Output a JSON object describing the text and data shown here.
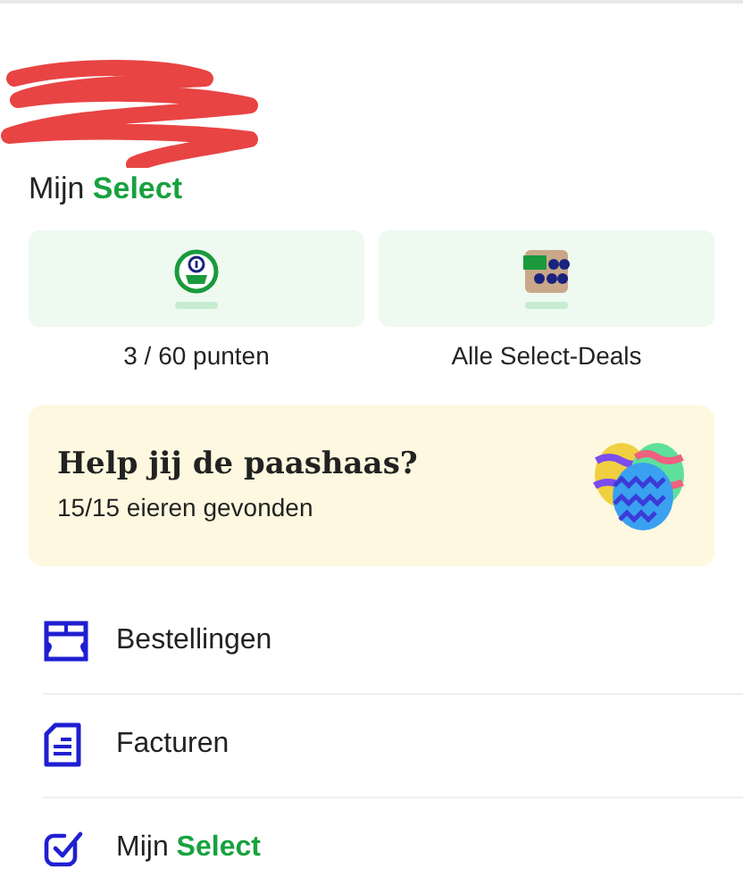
{
  "header": {
    "title_prefix": "Mijn",
    "title_brand": "Select"
  },
  "tiles": [
    {
      "kind": "points",
      "label": "3 / 60 punten"
    },
    {
      "kind": "deals",
      "label": "Alle Select-Deals"
    }
  ],
  "promo": {
    "title": "Help jij de paashaas?",
    "subtitle": "15/15 eieren gevonden"
  },
  "menu": [
    {
      "kind": "orders",
      "label": "Bestellingen"
    },
    {
      "kind": "invoices",
      "label": "Facturen"
    },
    {
      "kind": "select",
      "label": "Mijn",
      "brand": "Select"
    }
  ]
}
